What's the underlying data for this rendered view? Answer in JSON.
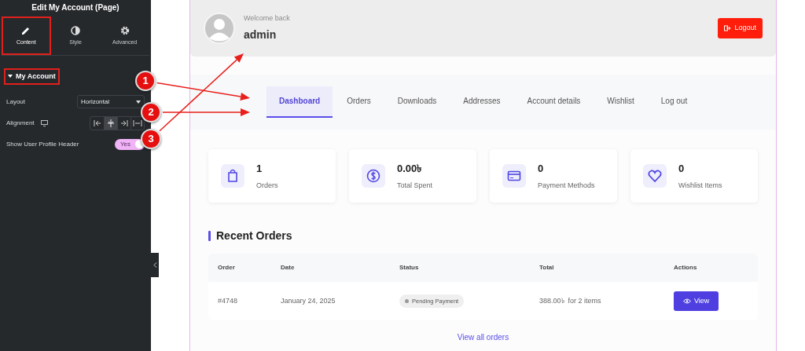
{
  "editor": {
    "title": "Edit My Account (Page)",
    "tabs": [
      {
        "label": "Content",
        "kind": "pencil",
        "selected": true,
        "highlighted": true
      },
      {
        "label": "Style",
        "kind": "contrast",
        "selected": false,
        "highlighted": false
      },
      {
        "label": "Advanced",
        "kind": "gear",
        "selected": false,
        "highlighted": false
      }
    ],
    "section": {
      "title": "My Account",
      "expanded": true,
      "highlighted": true
    },
    "controls": [
      {
        "kind": "select",
        "label": "Layout",
        "value": "Horizontal"
      },
      {
        "kind": "align",
        "label": "Alignment",
        "options": [
          {
            "kind": "left",
            "selected": false
          },
          {
            "kind": "center",
            "selected": true
          },
          {
            "kind": "right",
            "selected": false
          },
          {
            "kind": "justify",
            "selected": false
          }
        ]
      },
      {
        "kind": "switch",
        "label": "Show User Profile Header",
        "value": "Yes",
        "on": true
      }
    ]
  },
  "annotations": [
    {
      "number": "1"
    },
    {
      "number": "2"
    },
    {
      "number": "3"
    }
  ],
  "profile": {
    "greeting": "Welcome back",
    "name": "admin",
    "logout": "Logout"
  },
  "nav": [
    {
      "label": "Dashboard",
      "selected": true
    },
    {
      "label": "Orders",
      "selected": false
    },
    {
      "label": "Downloads",
      "selected": false
    },
    {
      "label": "Addresses",
      "selected": false
    },
    {
      "label": "Account details",
      "selected": false
    },
    {
      "label": "Wishlist",
      "selected": false
    },
    {
      "label": "Log out",
      "selected": false
    }
  ],
  "stats": [
    {
      "kind": "bag",
      "value": "1",
      "label": "Orders"
    },
    {
      "kind": "dollar",
      "value": "0.00৳",
      "label": "Total Spent"
    },
    {
      "kind": "card",
      "value": "0",
      "label": "Payment Methods"
    },
    {
      "kind": "heart",
      "value": "0",
      "label": "Wishlist Items"
    }
  ],
  "recent_orders": {
    "title": "Recent Orders",
    "columns": [
      "Order",
      "Date",
      "Status",
      "Total",
      "Actions"
    ],
    "rows": [
      {
        "order": "#4748",
        "date": "January 24, 2025",
        "status": "Pending Payment",
        "total": "388.00৳",
        "items": "for 2 items",
        "action": "View"
      }
    ],
    "view_all": "View all orders"
  }
}
